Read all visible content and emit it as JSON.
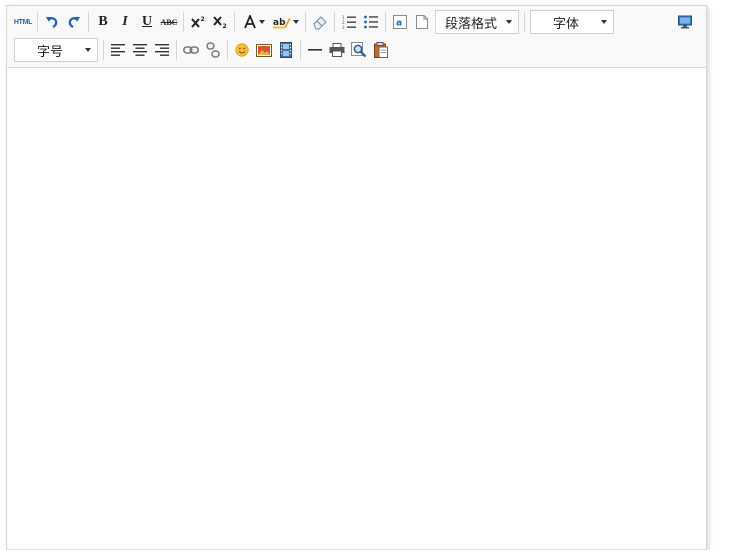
{
  "toolbar": {
    "html_label": "HTML",
    "bold_label": "B",
    "italic_label": "I",
    "underline_label": "U",
    "strike_label": "ABC",
    "paragraph_format": "段落格式",
    "font_family": "字体",
    "font_size": "字号",
    "accent_color": "#1a66b3"
  },
  "editor": {
    "content": ""
  }
}
